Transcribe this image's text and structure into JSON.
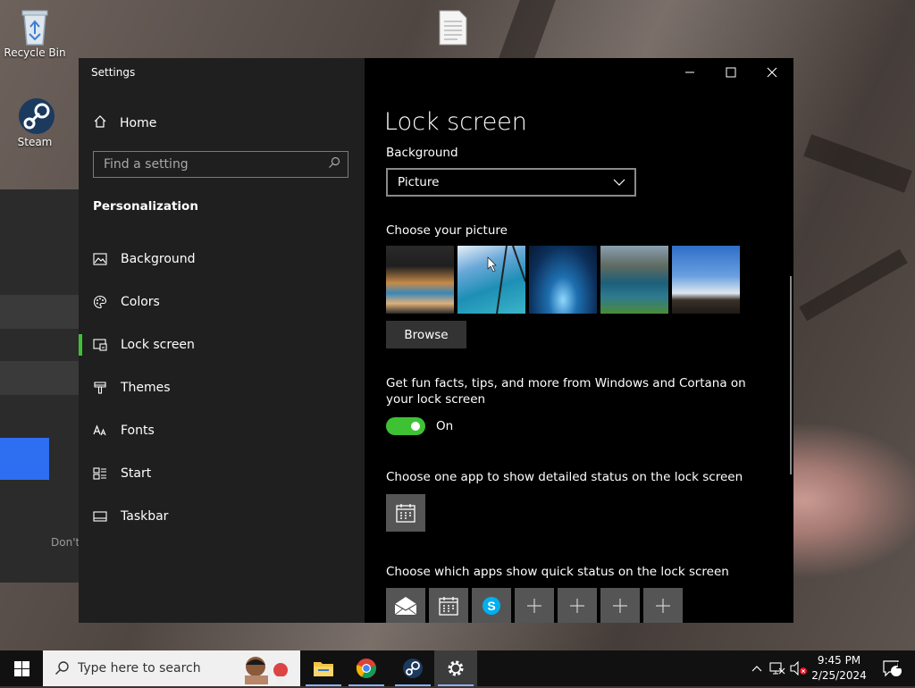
{
  "desktop": {
    "icons": [
      {
        "label": "Recycle Bin"
      },
      {
        "label": "Steam"
      }
    ],
    "background_window_text": "Don't"
  },
  "settings": {
    "window_title": "Settings",
    "sidebar": {
      "home_label": "Home",
      "search_placeholder": "Find a setting",
      "section_title": "Personalization",
      "items": [
        {
          "label": "Background",
          "icon": "picture-icon",
          "active": false
        },
        {
          "label": "Colors",
          "icon": "palette-icon",
          "active": false
        },
        {
          "label": "Lock screen",
          "icon": "lock-screen-icon",
          "active": true
        },
        {
          "label": "Themes",
          "icon": "brush-icon",
          "active": false
        },
        {
          "label": "Fonts",
          "icon": "font-icon",
          "active": false
        },
        {
          "label": "Start",
          "icon": "start-icon",
          "active": false
        },
        {
          "label": "Taskbar",
          "icon": "taskbar-icon",
          "active": false
        }
      ]
    },
    "main": {
      "title": "Lock screen",
      "background_label": "Background",
      "background_value": "Picture",
      "choose_picture_label": "Choose your picture",
      "browse_label": "Browse",
      "fun_facts_label": "Get fun facts, tips, and more from Windows and Cortana on your lock screen",
      "toggle_state": "On",
      "detailed_status_label": "Choose one app to show detailed status on the lock screen",
      "quick_status_label": "Choose which apps show quick status on the lock screen",
      "quick_apps": [
        "mail-icon",
        "calendar-icon",
        "skype-icon",
        "plus-icon",
        "plus-icon",
        "plus-icon",
        "plus-icon"
      ]
    }
  },
  "taskbar": {
    "search_placeholder": "Type here to search",
    "time": "9:45 PM",
    "date": "2/25/2024",
    "notification_count": "1",
    "accent": "#3ec234"
  }
}
